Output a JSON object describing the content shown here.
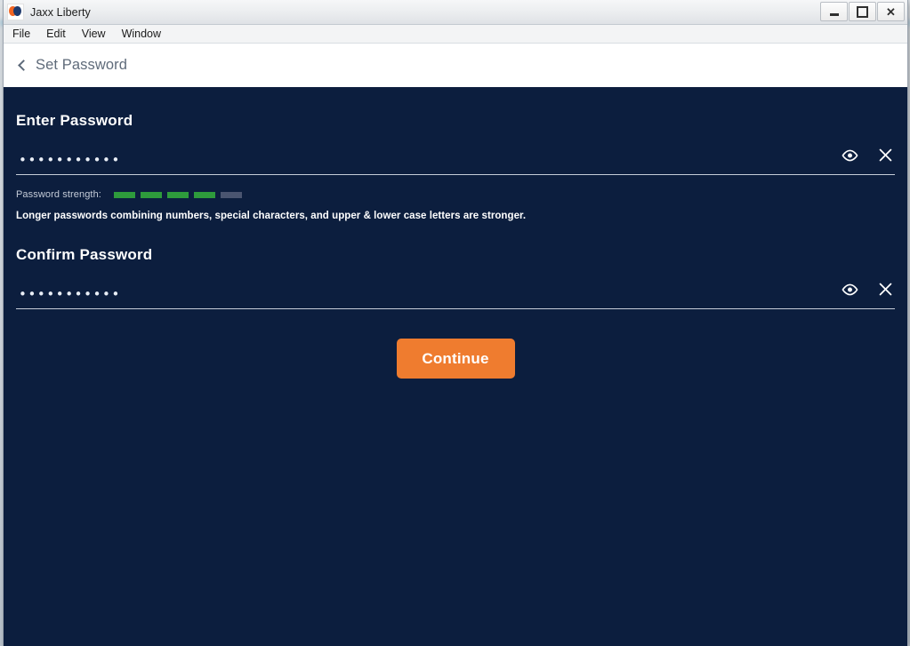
{
  "window": {
    "app_title": "Jaxx Liberty",
    "logo_icon": "jaxx-liberty-heart-logo",
    "minimize_label": "—",
    "maximize_label": "□",
    "close_label": "✕"
  },
  "menubar": {
    "items": [
      {
        "label": "File"
      },
      {
        "label": "Edit"
      },
      {
        "label": "View"
      },
      {
        "label": "Window"
      }
    ]
  },
  "subheader": {
    "back_icon": "chevron-left-icon",
    "title": "Set Password"
  },
  "main": {
    "enter_password": {
      "title": "Enter Password",
      "value": "•••••••••••",
      "placeholder": "Enter Password",
      "show_icon": "eye-icon",
      "clear_icon": "close-icon"
    },
    "strength": {
      "label": "Password strength:",
      "segments_total": 5,
      "segments_filled": 4,
      "filled_color": "#2e9b3c",
      "empty_color": "#4a5570"
    },
    "hint": "Longer passwords combining numbers, special characters, and upper & lower case letters are stronger.",
    "confirm_password": {
      "title": "Confirm Password",
      "value": "•••••••••••",
      "placeholder": "Confirm Password",
      "show_icon": "eye-icon",
      "clear_icon": "close-icon"
    },
    "continue_label": "Continue",
    "colors": {
      "background": "#0c1e3e",
      "accent": "#ef7c2f",
      "text": "#ffffff"
    }
  }
}
